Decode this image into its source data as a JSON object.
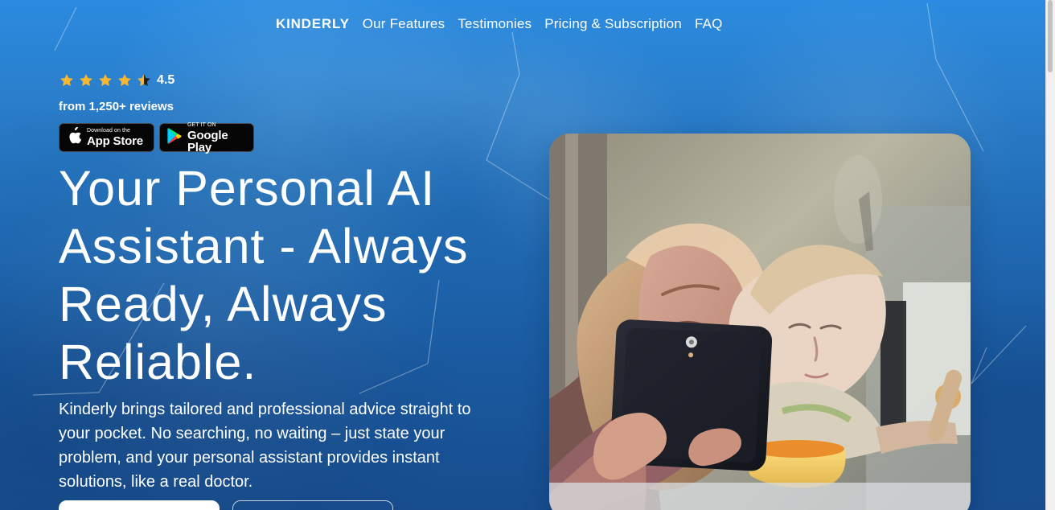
{
  "nav": {
    "brand": "KINDERLY",
    "items": [
      {
        "label": "Our Features"
      },
      {
        "label": "Testimonies"
      },
      {
        "label": "Pricing & Subscription"
      },
      {
        "label": "FAQ"
      }
    ]
  },
  "hero": {
    "rating": {
      "value": "4.5",
      "stars": 4.5,
      "reviews": "from 1,250+ reviews"
    },
    "stores": {
      "app_store_small": "Download on the",
      "app_store_big": "App Store",
      "google_play_small": "GET IT ON",
      "google_play_big": "Google Play"
    },
    "headline_lines": [
      "Your Personal AI",
      "Assistant - Always",
      "Ready, Always",
      "Reliable."
    ],
    "description_lines": [
      "Kinderly brings tailored and professional advice straight to",
      "your pocket. No searching, no waiting – just state your",
      "problem, and your personal assistant provides instant",
      "solutions, like a real doctor."
    ]
  },
  "colors": {
    "background_top": "#2b8be0",
    "background_bottom": "#174d8e",
    "star": "#f7b731",
    "text": "#ffffff"
  },
  "icons": {
    "apple": "apple-icon",
    "google_play": "google-play-icon",
    "star": "star-icon"
  }
}
